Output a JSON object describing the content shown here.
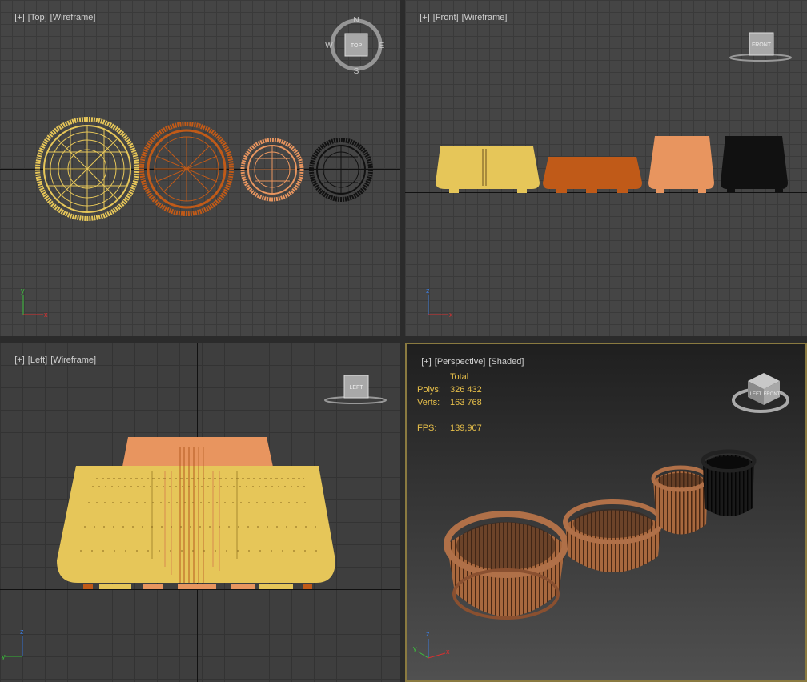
{
  "viewports": {
    "top": {
      "labels": [
        "[+]",
        "[Top]",
        "[Wireframe]"
      ],
      "compass": {
        "n": "N",
        "s": "S",
        "e": "E",
        "w": "W",
        "cube": "TOP"
      },
      "axes": {
        "a": "y",
        "b": "x"
      }
    },
    "front": {
      "labels": [
        "[+]",
        "[Front]",
        "[Wireframe]"
      ],
      "cube": "FRONT",
      "axes": {
        "a": "z",
        "b": "x"
      }
    },
    "left": {
      "labels": [
        "[+]",
        "[Left]",
        "[Wireframe]"
      ],
      "cube": "LEFT",
      "axes": {
        "a": "z",
        "b": "y"
      }
    },
    "perspective": {
      "labels": [
        "[+]",
        "[Perspective]",
        "[Shaded]"
      ],
      "cube": {
        "face1": "FRONT",
        "face2": "LEFT"
      },
      "stats": {
        "header": "Total",
        "polys_label": "Polys:",
        "polys_value": "326 432",
        "verts_label": "Verts:",
        "verts_value": "163 768",
        "fps_label": "FPS:",
        "fps_value": "139,907"
      },
      "axes": {
        "a": "z",
        "b": "y",
        "c": "x"
      }
    }
  },
  "colors": {
    "yellow": "#e6c659",
    "orange_dark": "#c05a18",
    "orange_light": "#e8955f",
    "black": "#111111",
    "wood": "#a0623a",
    "accent_border": "#8a7a40",
    "stat_text": "#e8c04a"
  }
}
